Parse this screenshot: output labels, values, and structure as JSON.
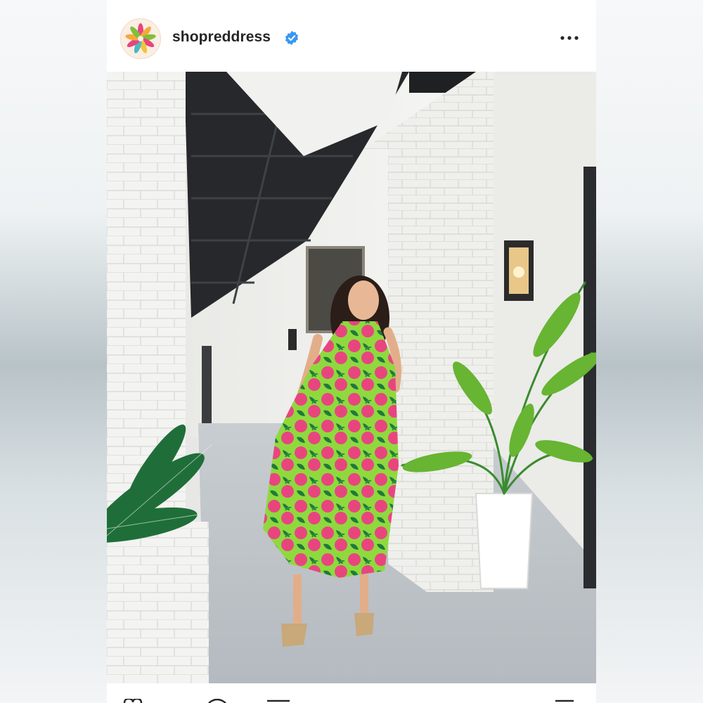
{
  "post": {
    "username": "shopreddress",
    "verified": true,
    "avatar_icon": "flower-logo-icon",
    "more_icon": "more-options-icon",
    "photo_alt": "",
    "actions": [
      "heart-icon",
      "comment-icon",
      "share-icon",
      "bookmark-icon"
    ]
  },
  "colors": {
    "username": "#262626",
    "verified_badge": "#3897f0",
    "dress_pink": "#e8457f",
    "dress_green": "#7fd13b",
    "leaf_dark": "#1f7a3a"
  }
}
